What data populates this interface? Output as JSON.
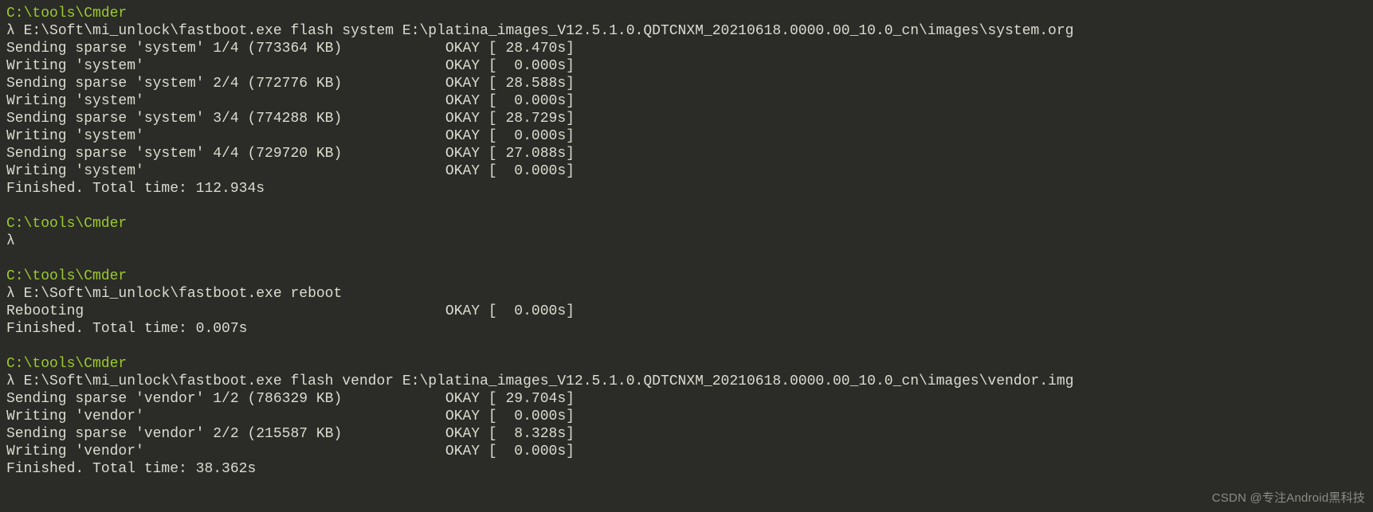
{
  "colors": {
    "background": "#2b2b28",
    "text": "#dcdcd0",
    "path": "#9bcb2a"
  },
  "watermark": "CSDN @专注Android黑科技",
  "blocks": [
    {
      "path": "C:\\tools\\Cmder",
      "prompt": "λ ",
      "command": "E:\\Soft\\mi_unlock\\fastboot.exe flash system E:\\platina_images_V12.5.1.0.QDTCNXM_20210618.0000.00_10.0_cn\\images\\system.org",
      "output": [
        "Sending sparse 'system' 1/4 (773364 KB)            OKAY [ 28.470s]",
        "Writing 'system'                                   OKAY [  0.000s]",
        "Sending sparse 'system' 2/4 (772776 KB)            OKAY [ 28.588s]",
        "Writing 'system'                                   OKAY [  0.000s]",
        "Sending sparse 'system' 3/4 (774288 KB)            OKAY [ 28.729s]",
        "Writing 'system'                                   OKAY [  0.000s]",
        "Sending sparse 'system' 4/4 (729720 KB)            OKAY [ 27.088s]",
        "Writing 'system'                                   OKAY [  0.000s]",
        "Finished. Total time: 112.934s"
      ]
    },
    {
      "path": "C:\\tools\\Cmder",
      "prompt": "λ",
      "command": "",
      "output": []
    },
    {
      "path": "C:\\tools\\Cmder",
      "prompt": "λ ",
      "command": "E:\\Soft\\mi_unlock\\fastboot.exe reboot",
      "output": [
        "Rebooting                                          OKAY [  0.000s]",
        "Finished. Total time: 0.007s"
      ]
    },
    {
      "path": "C:\\tools\\Cmder",
      "prompt": "λ ",
      "command": "E:\\Soft\\mi_unlock\\fastboot.exe flash vendor E:\\platina_images_V12.5.1.0.QDTCNXM_20210618.0000.00_10.0_cn\\images\\vendor.img",
      "output": [
        "Sending sparse 'vendor' 1/2 (786329 KB)            OKAY [ 29.704s]",
        "Writing 'vendor'                                   OKAY [  0.000s]",
        "Sending sparse 'vendor' 2/2 (215587 KB)            OKAY [  8.328s]",
        "Writing 'vendor'                                   OKAY [  0.000s]",
        "Finished. Total time: 38.362s"
      ]
    }
  ]
}
